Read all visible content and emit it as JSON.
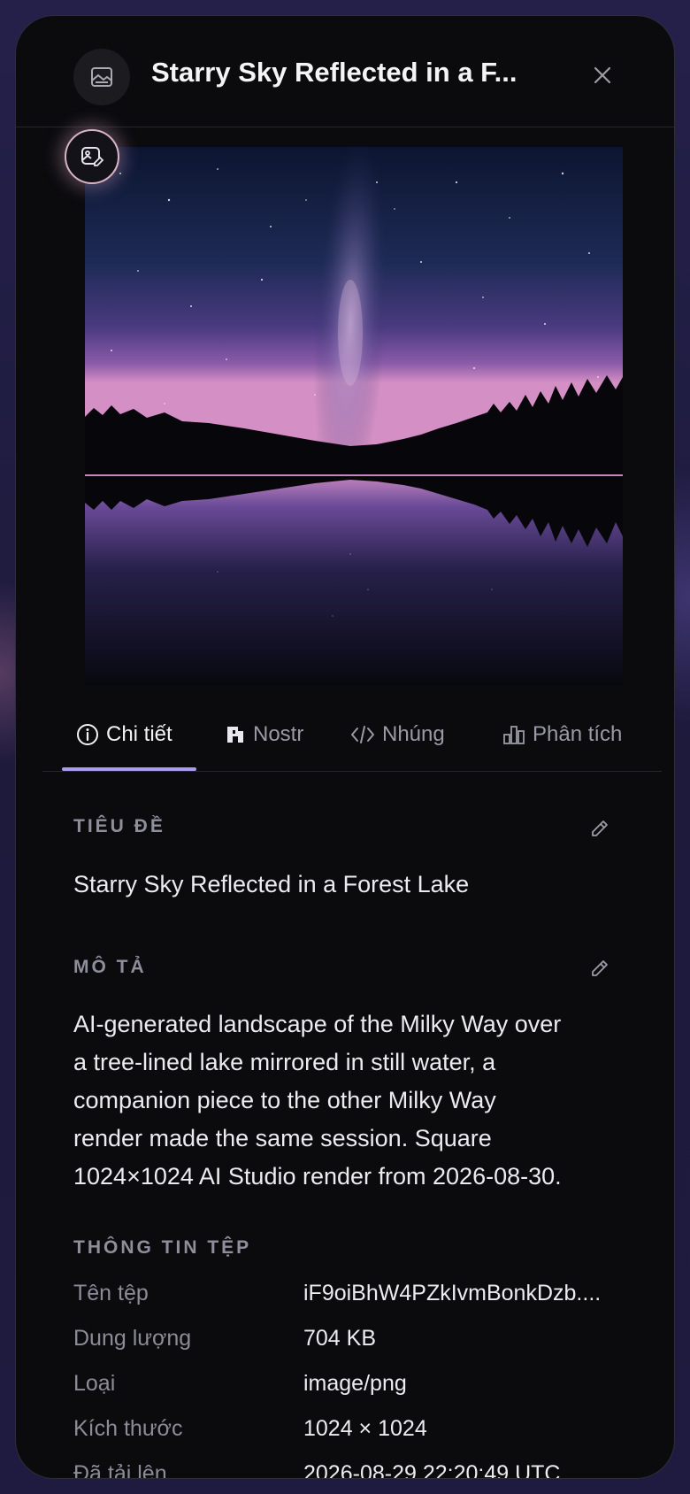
{
  "header": {
    "title": "Starry Sky Reflected in a F...",
    "icon": "image-icon",
    "close_icon": "close-icon"
  },
  "image": {
    "edit_icon": "image-edit-icon"
  },
  "tabs": [
    {
      "label": "Chi tiết",
      "icon": "info-icon",
      "active": true
    },
    {
      "label": "Nostr",
      "icon": "nostr-icon",
      "active": false
    },
    {
      "label": "Nhúng",
      "icon": "code-icon",
      "active": false
    },
    {
      "label": "Phân tích",
      "icon": "bar-chart-icon",
      "active": false
    }
  ],
  "details": {
    "title_label": "TIÊU ĐỀ",
    "title_value": "Starry Sky Reflected in a Forest Lake",
    "description_label": "MÔ TẢ",
    "description_lines": [
      "AI-generated landscape of the Milky Way over",
      "a tree-lined lake mirrored in still water, a",
      "companion piece to the other Milky Way",
      "render made the same session. Square",
      "1024×1024 AI Studio render from 2026-08-30."
    ],
    "file_info_label": "THÔNG TIN TỆP",
    "file_info": [
      {
        "key": "Tên tệp",
        "value": "iF9oiBhW4PZkIvmBonkDzb...."
      },
      {
        "key": "Dung lượng",
        "value": "704 KB"
      },
      {
        "key": "Loại",
        "value": "image/png"
      },
      {
        "key": "Kích thước",
        "value": "1024 × 1024"
      },
      {
        "key": "Đã tải lên",
        "value": "2026-08-29 22:20:49 UTC"
      }
    ]
  },
  "colors": {
    "accent": "#a99cf0",
    "panel_bg": "#0b0b0e"
  }
}
